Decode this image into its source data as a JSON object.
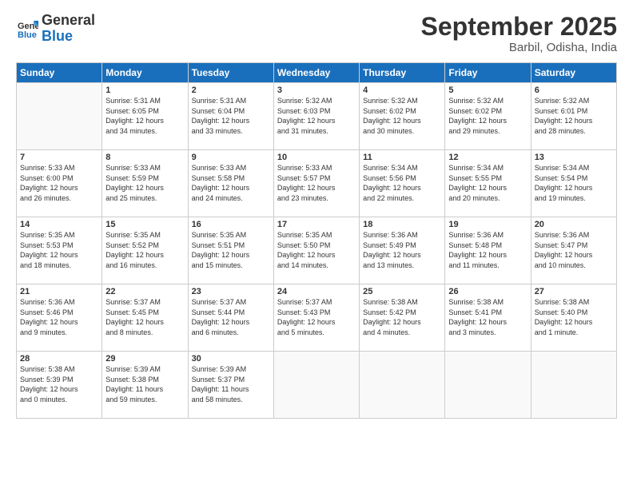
{
  "header": {
    "logo_general": "General",
    "logo_blue": "Blue",
    "month_title": "September 2025",
    "location": "Barbil, Odisha, India"
  },
  "weekdays": [
    "Sunday",
    "Monday",
    "Tuesday",
    "Wednesday",
    "Thursday",
    "Friday",
    "Saturday"
  ],
  "weeks": [
    [
      {
        "day": "",
        "info": ""
      },
      {
        "day": "1",
        "info": "Sunrise: 5:31 AM\nSunset: 6:05 PM\nDaylight: 12 hours\nand 34 minutes."
      },
      {
        "day": "2",
        "info": "Sunrise: 5:31 AM\nSunset: 6:04 PM\nDaylight: 12 hours\nand 33 minutes."
      },
      {
        "day": "3",
        "info": "Sunrise: 5:32 AM\nSunset: 6:03 PM\nDaylight: 12 hours\nand 31 minutes."
      },
      {
        "day": "4",
        "info": "Sunrise: 5:32 AM\nSunset: 6:02 PM\nDaylight: 12 hours\nand 30 minutes."
      },
      {
        "day": "5",
        "info": "Sunrise: 5:32 AM\nSunset: 6:02 PM\nDaylight: 12 hours\nand 29 minutes."
      },
      {
        "day": "6",
        "info": "Sunrise: 5:32 AM\nSunset: 6:01 PM\nDaylight: 12 hours\nand 28 minutes."
      }
    ],
    [
      {
        "day": "7",
        "info": "Sunrise: 5:33 AM\nSunset: 6:00 PM\nDaylight: 12 hours\nand 26 minutes."
      },
      {
        "day": "8",
        "info": "Sunrise: 5:33 AM\nSunset: 5:59 PM\nDaylight: 12 hours\nand 25 minutes."
      },
      {
        "day": "9",
        "info": "Sunrise: 5:33 AM\nSunset: 5:58 PM\nDaylight: 12 hours\nand 24 minutes."
      },
      {
        "day": "10",
        "info": "Sunrise: 5:33 AM\nSunset: 5:57 PM\nDaylight: 12 hours\nand 23 minutes."
      },
      {
        "day": "11",
        "info": "Sunrise: 5:34 AM\nSunset: 5:56 PM\nDaylight: 12 hours\nand 22 minutes."
      },
      {
        "day": "12",
        "info": "Sunrise: 5:34 AM\nSunset: 5:55 PM\nDaylight: 12 hours\nand 20 minutes."
      },
      {
        "day": "13",
        "info": "Sunrise: 5:34 AM\nSunset: 5:54 PM\nDaylight: 12 hours\nand 19 minutes."
      }
    ],
    [
      {
        "day": "14",
        "info": "Sunrise: 5:35 AM\nSunset: 5:53 PM\nDaylight: 12 hours\nand 18 minutes."
      },
      {
        "day": "15",
        "info": "Sunrise: 5:35 AM\nSunset: 5:52 PM\nDaylight: 12 hours\nand 16 minutes."
      },
      {
        "day": "16",
        "info": "Sunrise: 5:35 AM\nSunset: 5:51 PM\nDaylight: 12 hours\nand 15 minutes."
      },
      {
        "day": "17",
        "info": "Sunrise: 5:35 AM\nSunset: 5:50 PM\nDaylight: 12 hours\nand 14 minutes."
      },
      {
        "day": "18",
        "info": "Sunrise: 5:36 AM\nSunset: 5:49 PM\nDaylight: 12 hours\nand 13 minutes."
      },
      {
        "day": "19",
        "info": "Sunrise: 5:36 AM\nSunset: 5:48 PM\nDaylight: 12 hours\nand 11 minutes."
      },
      {
        "day": "20",
        "info": "Sunrise: 5:36 AM\nSunset: 5:47 PM\nDaylight: 12 hours\nand 10 minutes."
      }
    ],
    [
      {
        "day": "21",
        "info": "Sunrise: 5:36 AM\nSunset: 5:46 PM\nDaylight: 12 hours\nand 9 minutes."
      },
      {
        "day": "22",
        "info": "Sunrise: 5:37 AM\nSunset: 5:45 PM\nDaylight: 12 hours\nand 8 minutes."
      },
      {
        "day": "23",
        "info": "Sunrise: 5:37 AM\nSunset: 5:44 PM\nDaylight: 12 hours\nand 6 minutes."
      },
      {
        "day": "24",
        "info": "Sunrise: 5:37 AM\nSunset: 5:43 PM\nDaylight: 12 hours\nand 5 minutes."
      },
      {
        "day": "25",
        "info": "Sunrise: 5:38 AM\nSunset: 5:42 PM\nDaylight: 12 hours\nand 4 minutes."
      },
      {
        "day": "26",
        "info": "Sunrise: 5:38 AM\nSunset: 5:41 PM\nDaylight: 12 hours\nand 3 minutes."
      },
      {
        "day": "27",
        "info": "Sunrise: 5:38 AM\nSunset: 5:40 PM\nDaylight: 12 hours\nand 1 minute."
      }
    ],
    [
      {
        "day": "28",
        "info": "Sunrise: 5:38 AM\nSunset: 5:39 PM\nDaylight: 12 hours\nand 0 minutes."
      },
      {
        "day": "29",
        "info": "Sunrise: 5:39 AM\nSunset: 5:38 PM\nDaylight: 11 hours\nand 59 minutes."
      },
      {
        "day": "30",
        "info": "Sunrise: 5:39 AM\nSunset: 5:37 PM\nDaylight: 11 hours\nand 58 minutes."
      },
      {
        "day": "",
        "info": ""
      },
      {
        "day": "",
        "info": ""
      },
      {
        "day": "",
        "info": ""
      },
      {
        "day": "",
        "info": ""
      }
    ]
  ]
}
